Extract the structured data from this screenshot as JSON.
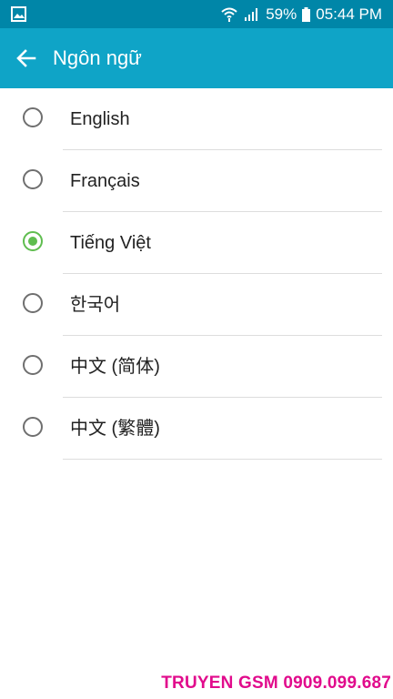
{
  "status_bar": {
    "battery_percent": "59%",
    "time": "05:44 PM",
    "icons": [
      "image-icon",
      "wifi-icon",
      "signal-icon",
      "battery-icon"
    ]
  },
  "app_bar": {
    "title": "Ngôn ngữ",
    "back_icon": "back-arrow-icon",
    "background": "#0fa4c7"
  },
  "languages": [
    {
      "label": "English",
      "selected": false
    },
    {
      "label": "Français",
      "selected": false
    },
    {
      "label": "Tiếng Việt",
      "selected": true
    },
    {
      "label": "한국어",
      "selected": false
    },
    {
      "label": "中文 (简体)",
      "selected": false
    },
    {
      "label": "中文 (繁體)",
      "selected": false
    }
  ],
  "watermark": "TRUYEN GSM 0909.099.687",
  "colors": {
    "status_bar": "#0086a8",
    "accent_selected": "#5fbd4f",
    "watermark": "#e10b8c"
  }
}
